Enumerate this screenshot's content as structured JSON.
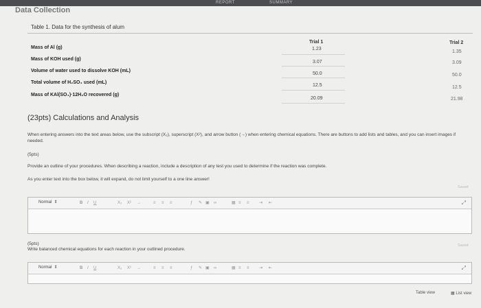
{
  "top_tabs": [
    "REPORT",
    "SUMMARY"
  ],
  "section_title": "Data Collection",
  "table": {
    "caption": "Table 1. Data for the synthesis of alum",
    "trial_headers": [
      "Trial 1",
      "Trial 2"
    ],
    "rows": [
      {
        "label": "Mass of Al (g)",
        "trial1": "1.23",
        "trial2": "1.35"
      },
      {
        "label": "Mass of KOH used (g)",
        "trial1": "3.07",
        "trial2": "3.09"
      },
      {
        "label": "Volume of water used to dissolve KOH (mL)",
        "trial1": "50.0",
        "trial2": "50.0"
      },
      {
        "label": "Total volume of H₂SO₄ used (mL)",
        "trial1": "12.5",
        "trial2": "12.5"
      },
      {
        "label": "Mass of KAl(SO₄)·12H₂O recovered (g)",
        "trial1": "20.09",
        "trial2": "21.98"
      }
    ]
  },
  "calc": {
    "heading": "(23pts) Calculations and Analysis",
    "instructions": "When entering answers into the text areas below, use the subscript (X₂), superscript (X²), and arrow button (→) when entering chemical equations. There are buttons to add lists and tables, and you can insert images if needed.",
    "q1_points": "(5pts)",
    "q1_text": "Provide an outline of your procedures. When describing a reaction, include a description of any test you used to determine if the reaction was complete.",
    "expand_note": "As you enter text into the box below, it will expand, do not limit yourself to a one line answer!",
    "q2_points": "(5pts)",
    "q2_text": "Write balanced chemical equations for each reaction in your outlined procedure."
  },
  "editor": {
    "format_select": "Normal",
    "bold": "B",
    "italic": "I",
    "underline": "U",
    "sub": "X₂",
    "sup": "X²",
    "arrow": "→"
  },
  "side_tags": [
    "Saved",
    "Saved"
  ],
  "footer": {
    "table_view": "Table view",
    "list_view": "List view"
  }
}
